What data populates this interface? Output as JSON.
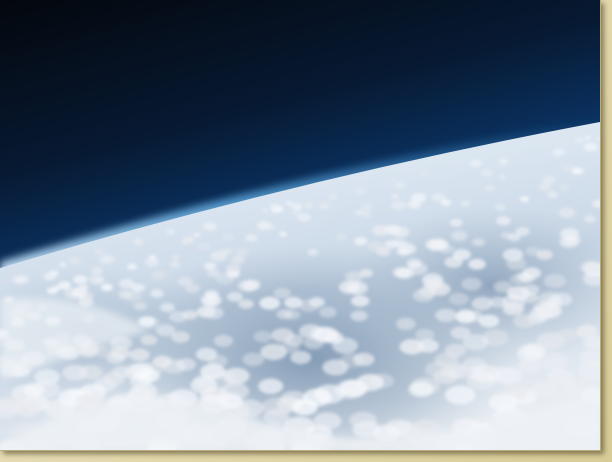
{
  "scene": {
    "subject": "earth-curvature-from-high-altitude",
    "colors": {
      "space": "#05080f",
      "upper_atmosphere": "#0a2b55",
      "horizon_glow": "#2b7cc4",
      "haze": "#d9e6f2",
      "cloud": "#f2f5f8",
      "ground_shadow": "#5c7795",
      "frame_mat": "#e8dfb8"
    }
  }
}
